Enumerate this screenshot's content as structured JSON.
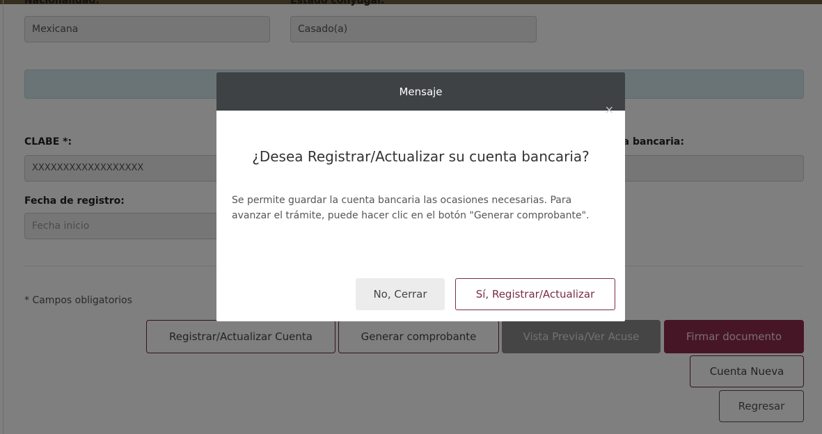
{
  "form": {
    "nacionalidad_label": "Nacionalidad:",
    "nacionalidad_value": "Mexicana",
    "estado_label": "Estado conyugal:",
    "estado_value": "Casado(a)",
    "clabe_label": "CLABE *:",
    "clabe_value": "XXXXXXXXXXXXXXXXXX",
    "cuenta_label_partial": "nta bancaria:",
    "fecha_label": "Fecha de registro:",
    "fecha_placeholder": "Fecha inicio",
    "required_note": "* Campos obligatorios"
  },
  "actions": {
    "registrar": "Registrar/Actualizar Cuenta",
    "generar": "Generar comprobante",
    "vista_previa": "Vista Previa/Ver Acuse",
    "firmar": "Firmar documento",
    "cuenta_nueva": "Cuenta Nueva",
    "regresar": "Regresar"
  },
  "modal": {
    "header": "Mensaje",
    "close_glyph": "×",
    "title": "¿Desea Registrar/Actualizar su cuenta bancaria?",
    "body": "Se permite guardar la cuenta bancaria las ocasiones necesarias. Para avanzar el trámite, puede hacer clic en el botón \"Generar comprobante\".",
    "no_button": "No, Cerrar",
    "yes_button": "Sí, Registrar/Actualizar"
  },
  "colors": {
    "accent_maroon": "#8f2c4c",
    "modal_header": "#3e4244",
    "banner": "#d4e8ee"
  },
  "icons": {
    "close": "close-icon"
  }
}
